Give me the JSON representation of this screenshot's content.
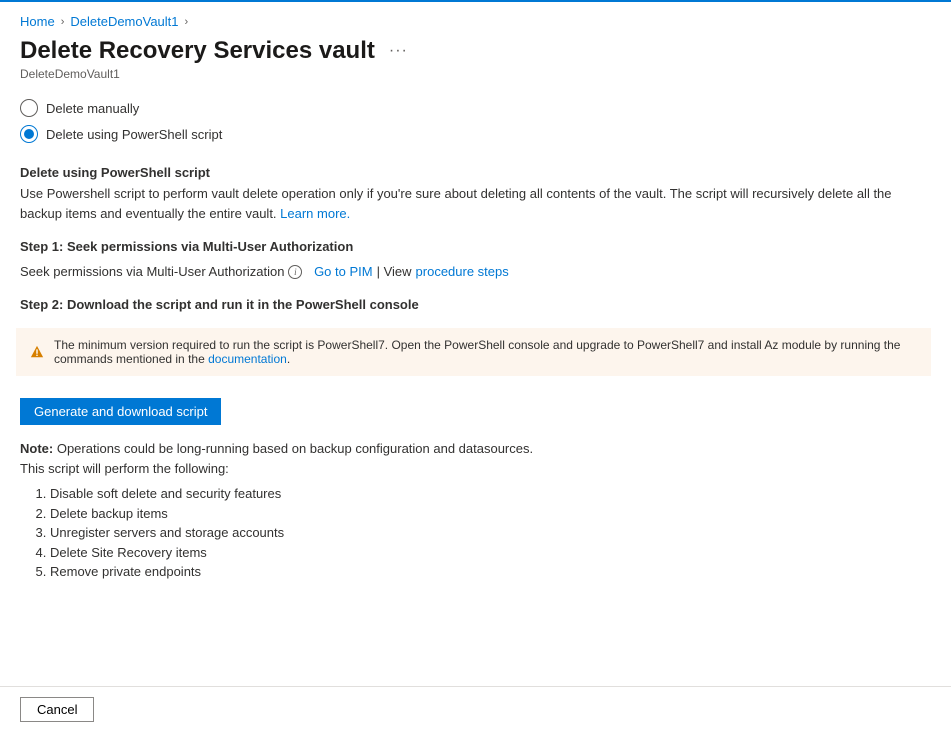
{
  "breadcrumb": {
    "home": "Home",
    "vault": "DeleteDemoVault1"
  },
  "header": {
    "title": "Delete Recovery Services vault",
    "subtitle": "DeleteDemoVault1"
  },
  "radios": {
    "manual": "Delete manually",
    "script": "Delete using PowerShell script"
  },
  "scriptSection": {
    "heading": "Delete using PowerShell script",
    "desc1": "Use Powershell script to perform vault delete operation only if you're sure about deleting all contents of the vault. The script will recursively delete all the backup items and eventually the entire vault. ",
    "learnMore": "Learn more."
  },
  "step1": {
    "title": "Step 1: Seek permissions via Multi-User Authorization",
    "lead": "Seek permissions via Multi-User Authorization",
    "goToPIM": "Go to PIM",
    "view": " | View ",
    "procedure": "procedure steps"
  },
  "step2": {
    "title": "Step 2: Download the script and run it in the PowerShell console"
  },
  "warning": {
    "text": "The minimum version required to run the script is PowerShell7. Open the PowerShell console and upgrade to PowerShell7 and install Az module by running the commands mentioned in the ",
    "docLink": "documentation",
    "trail": "."
  },
  "buttons": {
    "generate": "Generate and download script",
    "cancel": "Cancel"
  },
  "note": {
    "label": "Note:",
    "text": " Operations could be long-running based on backup configuration and datasources.",
    "followup": "This script will perform the following:"
  },
  "ops": {
    "i1": "Disable soft delete and security features",
    "i2": "Delete backup items",
    "i3": "Unregister servers and storage accounts",
    "i4": "Delete Site Recovery items",
    "i5": "Remove private endpoints"
  }
}
